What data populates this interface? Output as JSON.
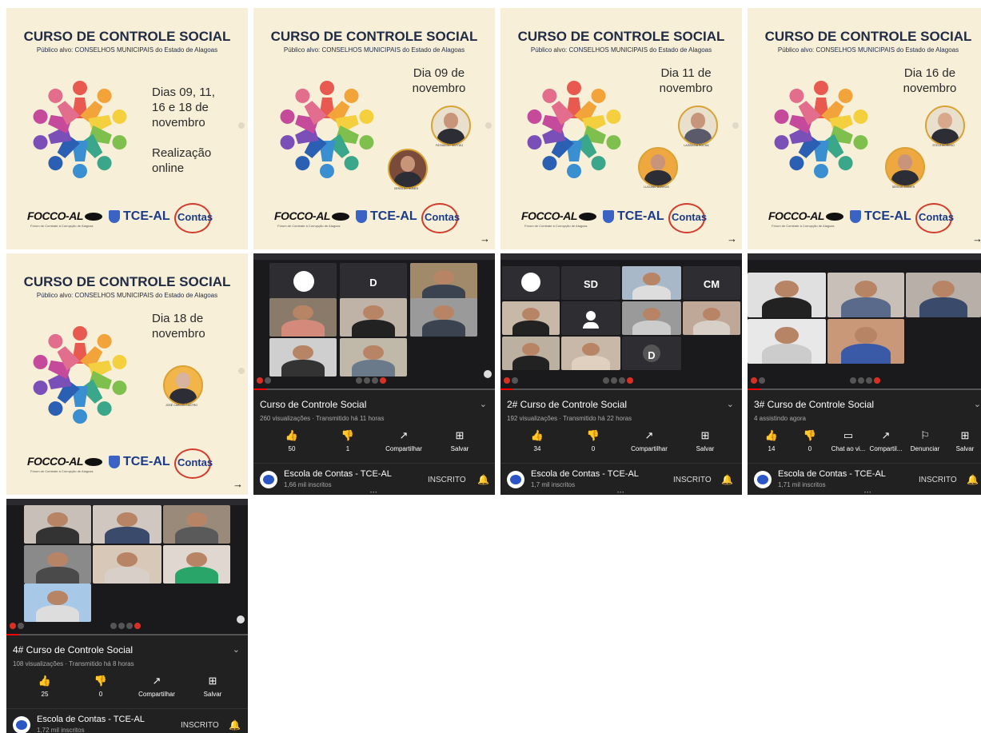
{
  "poster_common": {
    "title": "CURSO DE CONTROLE SOCIAL",
    "subtitle": "Público alvo: CONSELHOS MUNICIPAIS do Estado de Alagoas",
    "logo_focco": "FOCCO-AL",
    "logo_focco_tag": "Fórum de Combate à Corrupção de Alagoas",
    "logo_tce": "TCE-AL",
    "logo_contas": "Contas",
    "arrow": "→"
  },
  "posters": [
    {
      "date_prefix": "Dias ",
      "date_line1": "09, 11,",
      "date_line2": "16 e 18 de",
      "date_line3": "novembro",
      "realizacao1": "Realização",
      "realizacao2": "online"
    },
    {
      "date_line1": "Dia 09 de",
      "date_line2": "novembro",
      "captions": [
        "FÁTIMA DO SERTÃO",
        "GERALDO NUNES"
      ]
    },
    {
      "date_line1": "Dia 11 de",
      "date_line2": "novembro",
      "captions": [
        "LAÍSSA DA ROCHA",
        "LUCIANO BARROS"
      ]
    },
    {
      "date_line1": "Dia 16 de",
      "date_line2": "novembro",
      "captions": [
        "STELA MORENO",
        "SÉRGIO ZIMMER"
      ]
    },
    {
      "date_line1": "Dia 18 de",
      "date_line2": "novembro",
      "captions": [
        "JOSÉ CARLOS CASTRO"
      ]
    }
  ],
  "videos": [
    {
      "title": "Curso de Controle Social",
      "meta": "260 visualizações · Transmitido há 11 horas",
      "likes": "50",
      "dislikes": "1",
      "share": "Compartilhar",
      "save": "Salvar",
      "channel": "Escola de Contas - TCE-AL",
      "subs": "1,66 mil inscritos",
      "subscribed": "INSCRITO",
      "tiles": [
        "",
        "D",
        "",
        "",
        "",
        "",
        "",
        ""
      ]
    },
    {
      "title": "2# Curso de Controle Social",
      "meta": "192 visualizações · Transmitido há 22 horas",
      "likes": "34",
      "dislikes": "0",
      "share": "Compartilhar",
      "save": "Salvar",
      "channel": "Escola de Contas - TCE-AL",
      "subs": "1,7 mil inscritos",
      "subscribed": "INSCRITO",
      "tiles": [
        "",
        "SD",
        "",
        "CM",
        "",
        "",
        "",
        "",
        "",
        "",
        "D"
      ]
    },
    {
      "title": "3# Curso de Controle Social",
      "meta": "4 assistindo agora",
      "likes": "14",
      "dislikes": "0",
      "chat": "Chat ao vi...",
      "share": "Compartil...",
      "report": "Denunciar",
      "save": "Salvar",
      "channel": "Escola de Contas - TCE-AL",
      "subs": "1,71 mil inscritos",
      "subscribed": "INSCRITO"
    },
    {
      "title": "4# Curso de Controle Social",
      "meta": "108 visualizações · Transmitido há 8 horas",
      "likes": "25",
      "dislikes": "0",
      "share": "Compartilhar",
      "save": "Salvar",
      "channel": "Escola de Contas - TCE-AL",
      "subs": "1,72 mil inscritos",
      "subscribed": "INSCRITO"
    }
  ],
  "icons": {
    "like": "like-icon",
    "dislike": "dislike-icon",
    "share": "share-icon",
    "save": "save-icon",
    "chat": "chat-icon",
    "report": "flag-icon",
    "bell": "bell-icon",
    "chevron": "chevron-down-icon"
  },
  "colors": {
    "poster_bg": "#f7efd8",
    "title": "#1f2a44",
    "video_bg": "#212121",
    "progress": "#ff0000"
  }
}
